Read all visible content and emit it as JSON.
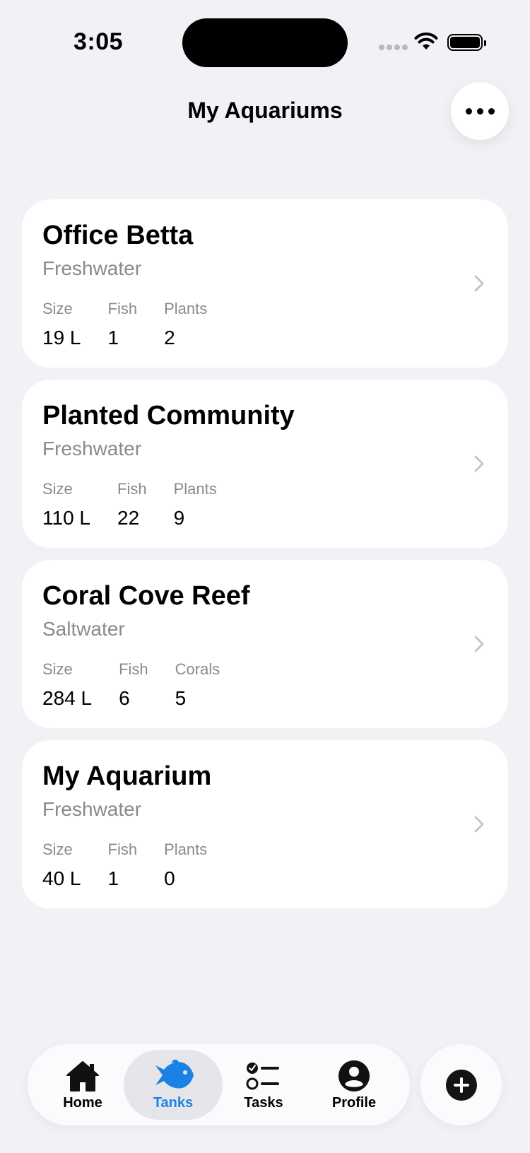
{
  "status_bar": {
    "time": "3:05"
  },
  "header": {
    "title": "My Aquariums",
    "more_icon": "ellipsis-icon"
  },
  "tanks": [
    {
      "name": "Office Betta",
      "type": "Freshwater",
      "stats": [
        {
          "label": "Size",
          "value": "19 L"
        },
        {
          "label": "Fish",
          "value": "1"
        },
        {
          "label": "Plants",
          "value": "2"
        }
      ]
    },
    {
      "name": "Planted Community",
      "type": "Freshwater",
      "stats": [
        {
          "label": "Size",
          "value": "110 L"
        },
        {
          "label": "Fish",
          "value": "22"
        },
        {
          "label": "Plants",
          "value": "9"
        }
      ]
    },
    {
      "name": "Coral Cove Reef",
      "type": "Saltwater",
      "stats": [
        {
          "label": "Size",
          "value": "284 L"
        },
        {
          "label": "Fish",
          "value": "6"
        },
        {
          "label": "Corals",
          "value": "5"
        }
      ]
    },
    {
      "name": "My Aquarium",
      "type": "Freshwater",
      "stats": [
        {
          "label": "Size",
          "value": "40 L"
        },
        {
          "label": "Fish",
          "value": "1"
        },
        {
          "label": "Plants",
          "value": "0"
        }
      ]
    }
  ],
  "tab_bar": {
    "tabs": [
      {
        "label": "Home",
        "icon": "house-icon",
        "active": false
      },
      {
        "label": "Tanks",
        "icon": "fish-icon",
        "active": true
      },
      {
        "label": "Tasks",
        "icon": "checklist-icon",
        "active": false
      },
      {
        "label": "Profile",
        "icon": "person-icon",
        "active": false
      }
    ],
    "accent_color": "#1a82e6"
  },
  "add_button": {
    "icon": "plus-icon"
  }
}
